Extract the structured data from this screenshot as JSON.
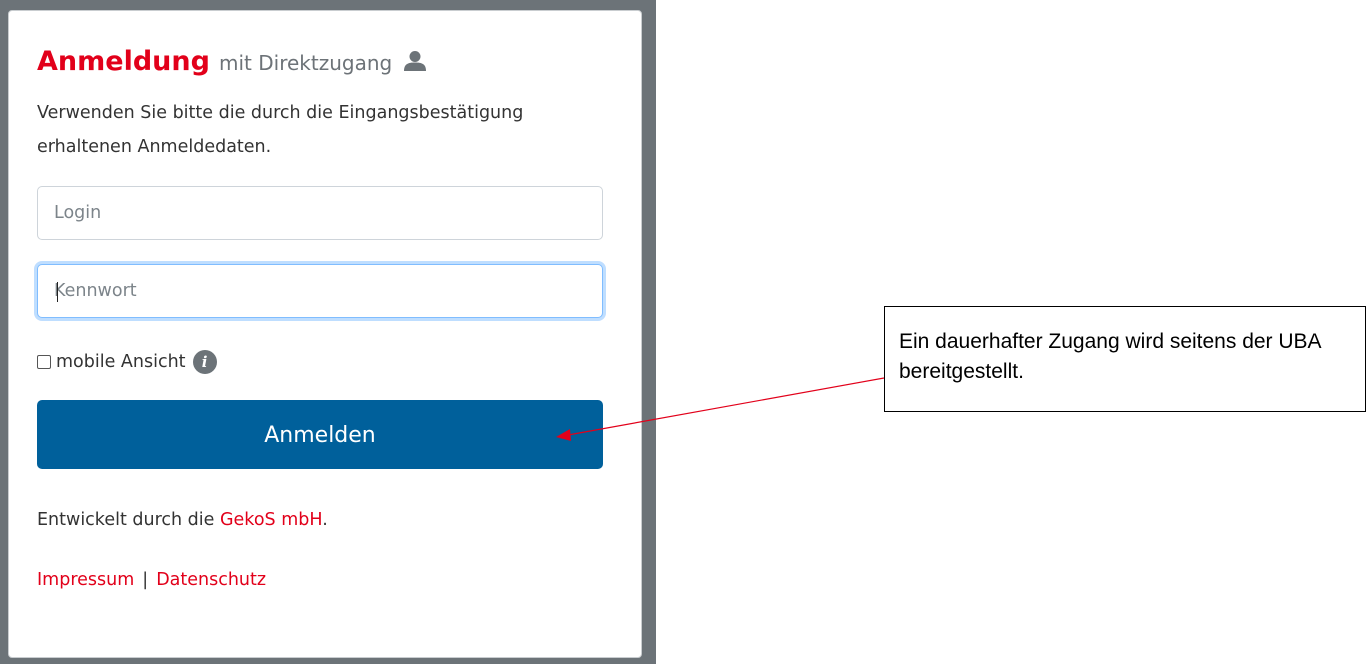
{
  "login_card": {
    "title_main": "Anmeldung",
    "title_sub": "mit Direktzugang",
    "title_icon": "user-icon",
    "intro_text": "Verwenden Sie bitte die durch die Eingangsbestätigung erhaltenen Anmeldedaten.",
    "login_placeholder": "Login",
    "password_placeholder": "Kennwort",
    "mobile_checkbox_label": "mobile Ansicht",
    "mobile_checkbox_checked": false,
    "info_icon": "info-icon",
    "submit_label": "Anmelden",
    "developer_prefix": "Entwickelt durch die",
    "developer_link": "GekoS mbH",
    "developer_suffix": ".",
    "imprint_link": "Impressum",
    "link_separator": "|",
    "privacy_link": "Datenschutz"
  },
  "annotation": {
    "callout_text": "Ein dauerhafter Zugang wird seitens der UBA bereitgestellt.",
    "arrow_color": "#e2001a"
  },
  "colors": {
    "brand_red": "#e2001a",
    "button_blue": "#00609b",
    "backdrop_gray": "#6c7378"
  }
}
